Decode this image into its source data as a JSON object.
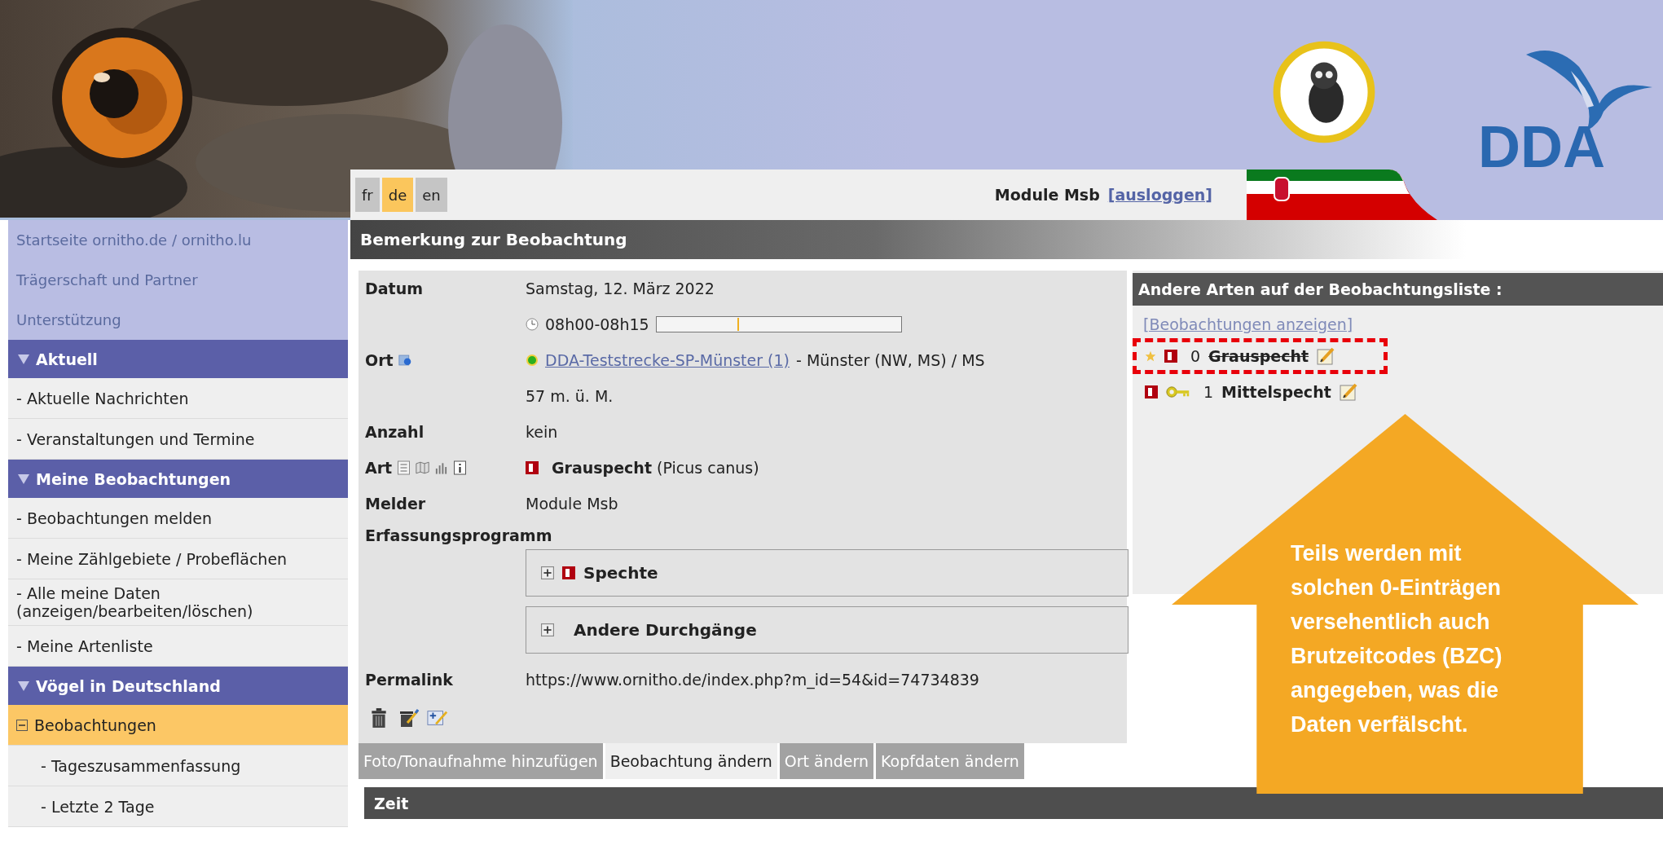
{
  "header": {
    "languages": [
      {
        "label": "fr",
        "selected": false
      },
      {
        "label": "de",
        "selected": true
      },
      {
        "label": "en",
        "selected": false
      }
    ],
    "user": "Module Msb",
    "logout": "[ausloggen]",
    "logo_text": "DDA"
  },
  "sidebar": {
    "links": [
      "Startseite ornitho.de / ornitho.lu",
      "Trägerschaft und Partner",
      "Unterstützung"
    ],
    "sections": [
      {
        "title": "Aktuell",
        "expanded": true,
        "items": [
          {
            "label": "- Aktuelle Nachrichten",
            "selected": false
          },
          {
            "label": "- Veranstaltungen und Termine",
            "selected": false
          }
        ]
      },
      {
        "title": "Meine Beobachtungen",
        "expanded": true,
        "items": [
          {
            "label": "- Beobachtungen melden",
            "selected": false
          },
          {
            "label": "- Meine Zählgebiete / Probeflächen",
            "selected": false
          },
          {
            "label": "- Alle meine Daten (anzeigen/bearbeiten/löschen)",
            "selected": false
          },
          {
            "label": "- Meine Artenliste",
            "selected": false
          }
        ]
      },
      {
        "title": "Vögel in Deutschland",
        "expanded": true,
        "items": [
          {
            "label": "Beobachtungen",
            "selected": true,
            "expanded": true,
            "children": [
              {
                "label": "- Tageszusammenfassung",
                "selected": false
              },
              {
                "label": "- Letzte 2 Tage",
                "selected": false
              }
            ]
          }
        ]
      }
    ]
  },
  "observation": {
    "title": "Bemerkung zur Beobachtung",
    "rows": [
      {
        "kind": "text",
        "label": "Datum",
        "value": "Samstag, 12. März 2022"
      },
      {
        "kind": "time",
        "value": "08h00-08h15",
        "level": 0.33
      },
      {
        "kind": "place",
        "label": "Ort",
        "link": "DDA-Teststrecke-SP-Münster (1)",
        "value": "- Münster (NW, MS) / MS"
      },
      {
        "kind": "text",
        "value": "57 m. ü. M."
      },
      {
        "kind": "text",
        "label": "Anzahl",
        "value": "kein"
      },
      {
        "kind": "species",
        "label": "Art",
        "value": "**Grauspecht** (Picus canus)"
      },
      {
        "kind": "text",
        "label": "Melder",
        "value": "Module Msb"
      },
      {
        "kind": "programs",
        "label": "Erfassungsprogramm",
        "items": [
          {
            "label": "Spechte",
            "expanded": false,
            "status_icon": true
          },
          {
            "label": "Andere Durchgänge",
            "expanded": false,
            "status_icon": false
          }
        ]
      },
      {
        "kind": "text",
        "label": "Permalink",
        "value": "https://www.ornitho.de/index.php?m_id=54&id=74734839"
      },
      {
        "kind": "actions"
      }
    ],
    "tabs": [
      {
        "label": "Foto/Tonaufnahme hinzufügen",
        "selected": false
      },
      {
        "label": "Beobachtung ändern",
        "selected": true
      },
      {
        "label": "Ort ändern",
        "selected": false
      },
      {
        "label": "Kopfdaten ändern",
        "selected": false
      }
    ],
    "section": "Zeit"
  },
  "other_species": {
    "title": "Andere Arten auf der Beobachtungsliste :",
    "link": "[Beobachtungen anzeigen]",
    "items": [
      {
        "count": "0",
        "name": "Grauspecht",
        "struck": true,
        "starred": true,
        "key": false,
        "highlighted": true
      },
      {
        "count": "1",
        "name": "Mittelspecht",
        "struck": false,
        "starred": false,
        "key": true,
        "highlighted": false
      }
    ]
  },
  "callout": {
    "text": "Teils werden mit solchen 0-Einträgen versehentlich auch Brutzeitcodes (BZC) angegeben, was die Daten verfälscht."
  }
}
